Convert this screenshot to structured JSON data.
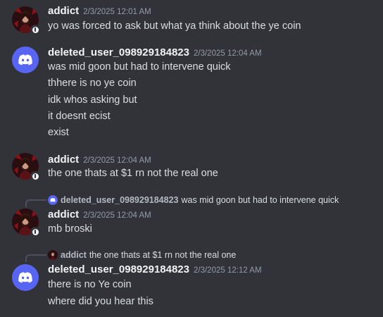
{
  "messages": [
    {
      "author": "addict",
      "timestamp": "2/3/2025 12:01 AM",
      "avatar": "addict-avatar",
      "lines": [
        "yo was forced to ask but what ya think about the ye coin"
      ]
    },
    {
      "author": "deleted_user_098929184823",
      "timestamp": "2/3/2025 12:04 AM",
      "avatar": "discord-logo-avatar",
      "lines": [
        "was mid goon but had to intervene quick",
        "thhere is no ye coin",
        "idk whos asking but",
        "it doesnt ecist",
        "exist"
      ]
    },
    {
      "author": "addict",
      "timestamp": "2/3/2025 12:04 AM",
      "avatar": "addict-avatar",
      "lines": [
        "the one thats at $1 rn not the real one"
      ]
    },
    {
      "reply_to": {
        "author": "deleted_user_098929184823",
        "text": "was mid goon but had to intervene quick"
      },
      "author": "addict",
      "timestamp": "2/3/2025 12:04 AM",
      "avatar": "addict-avatar",
      "lines": [
        "mb broski"
      ]
    },
    {
      "reply_to": {
        "author": "addict",
        "text": "the one thats at $1 rn not the real one"
      },
      "author": "deleted_user_098929184823",
      "timestamp": "2/3/2025 12:12 AM",
      "avatar": "discord-logo-avatar",
      "lines": [
        "there is no Ye coin",
        "where did you hear this"
      ]
    }
  ],
  "colors": {
    "background": "#313338",
    "discord_blurple": "#5865f2",
    "username": "#f2f3f5",
    "timestamp": "#949ba4",
    "text": "#dbdee1"
  }
}
